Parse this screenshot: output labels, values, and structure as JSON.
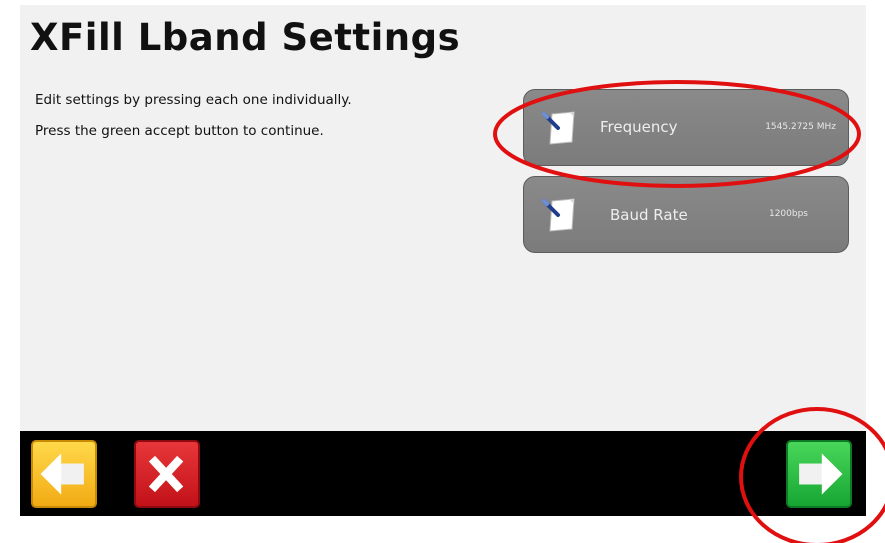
{
  "title": "XFill Lband Settings",
  "instructions": {
    "line1": "Edit settings by pressing each one individually.",
    "line2": "Press the green accept button to continue."
  },
  "settings": [
    {
      "label": "Frequency",
      "value": "1545.2725 MHz",
      "icon": "document-edit-icon"
    },
    {
      "label": "Baud Rate",
      "value": "1200bps",
      "icon": "document-edit-icon"
    }
  ],
  "nav": {
    "back_icon": "left-arrow-icon",
    "cancel_icon": "x-icon",
    "accept_icon": "right-arrow-icon"
  },
  "colors": {
    "back": "#f2ab14",
    "cancel": "#c21219",
    "accept": "#16a633",
    "annotation": "#e01010"
  }
}
